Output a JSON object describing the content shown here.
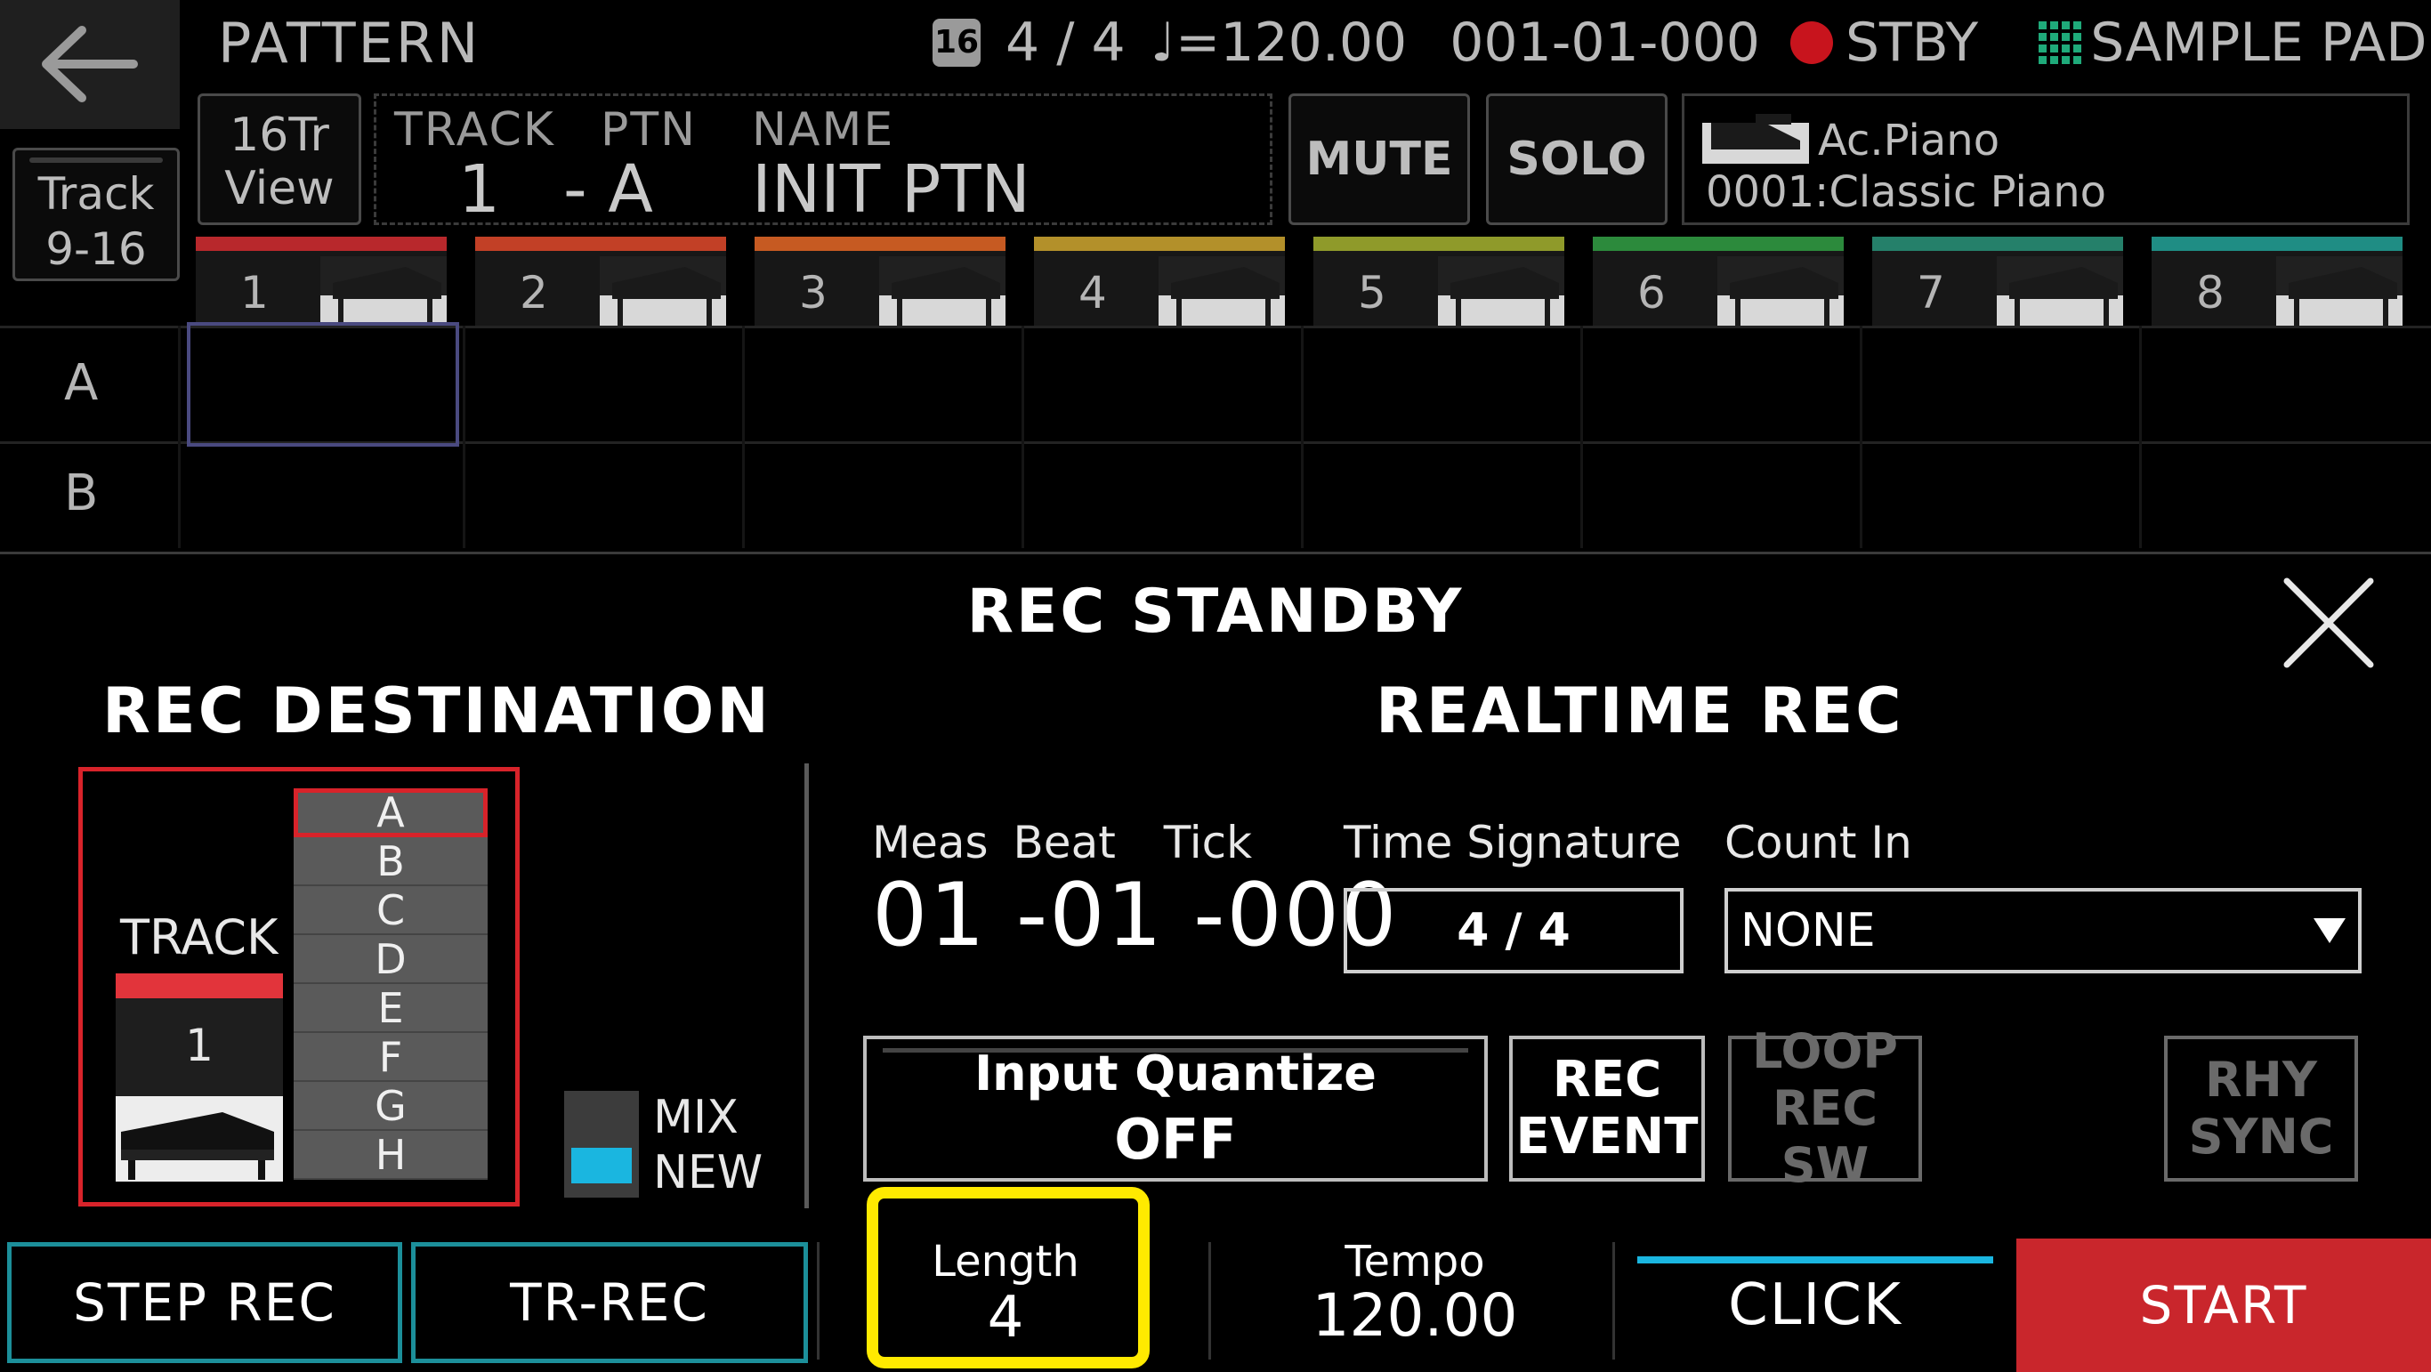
{
  "header": {
    "title": "PATTERN",
    "badge": "16",
    "time_sig": "4 / 4",
    "tempo": "♩=120.00",
    "position": "001-01-000",
    "status": "STBY",
    "sample_pad": "SAMPLE PAD"
  },
  "track_bar": {
    "track_9_16": [
      "Track",
      "9-16"
    ],
    "view_16tr": [
      "16Tr",
      "View"
    ],
    "track_label": "TRACK",
    "track_value": "1",
    "ptn_label": "PTN",
    "ptn_value": "- A",
    "name_label": "NAME",
    "name_value": "INIT PTN",
    "mute": "MUTE",
    "solo": "SOLO",
    "tone_category": "Ac.Piano",
    "tone_name": "0001:Classic Piano"
  },
  "tracks": [
    {
      "num": "1",
      "color": "#b8282c"
    },
    {
      "num": "2",
      "color": "#c24026"
    },
    {
      "num": "3",
      "color": "#c65a22"
    },
    {
      "num": "4",
      "color": "#b3902a"
    },
    {
      "num": "5",
      "color": "#8f9a2a"
    },
    {
      "num": "6",
      "color": "#2c8a3c"
    },
    {
      "num": "7",
      "color": "#25806a"
    },
    {
      "num": "8",
      "color": "#1f8d84"
    }
  ],
  "pattern_rows": [
    "A",
    "B"
  ],
  "dialog": {
    "title": "REC STANDBY",
    "rec_destination": "REC DESTINATION",
    "realtime_rec": "REALTIME REC",
    "track_label": "TRACK",
    "track_num": "1",
    "patterns": [
      "A",
      "B",
      "C",
      "D",
      "E",
      "F",
      "G",
      "H"
    ],
    "selected_pattern": "A",
    "mix_label": "MIX",
    "new_label": "NEW",
    "meas_label": "Meas",
    "beat_label": "Beat",
    "tick_label": "Tick",
    "position_value": "01 -01 -000",
    "time_signature_label": "Time Signature",
    "time_signature_value": "4 / 4",
    "count_in_label": "Count In",
    "count_in_value": "NONE",
    "input_quantize_label": "Input Quantize",
    "input_quantize_value": "OFF",
    "rec_event": [
      "REC",
      "EVENT"
    ],
    "loop_rec_sw": [
      "LOOP",
      "REC SW"
    ],
    "rhy_sync": [
      "RHY",
      "SYNC"
    ]
  },
  "bottom": {
    "step_rec": "STEP REC",
    "tr_rec": "TR-REC",
    "length_label": "Length",
    "length_value": "4",
    "tempo_label": "Tempo",
    "tempo_value": "120.00",
    "click": "CLICK",
    "start": "START"
  },
  "colors": {
    "accent_red": "#d8232a",
    "accent_cyan": "#1ab6e0",
    "highlight": "#ffea00",
    "teal_border": "#1c8f9a"
  }
}
